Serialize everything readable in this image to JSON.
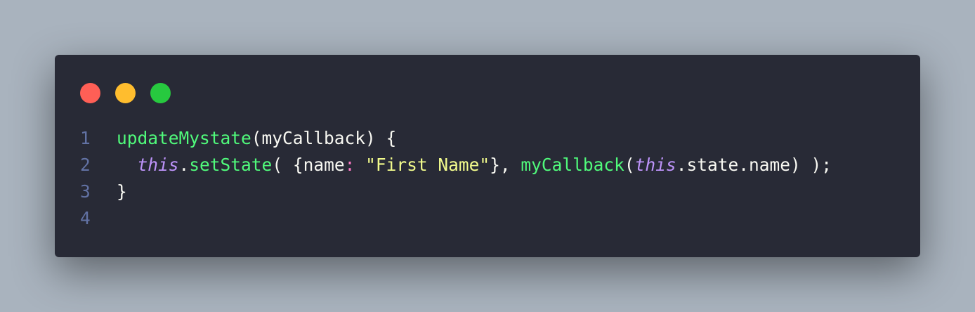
{
  "theme": {
    "background": "#282a36",
    "foreground": "#f8f8f2",
    "line_number": "#6272a4",
    "function": "#50fa7b",
    "keyword": "#bd93f9",
    "string": "#f1fa8c",
    "operator": "#ff79c6",
    "window_close": "#ff5f56",
    "window_minimize": "#ffbd2e",
    "window_maximize": "#27c93f"
  },
  "window_controls": [
    "close",
    "minimize",
    "maximize"
  ],
  "code": {
    "language": "javascript",
    "lines": [
      {
        "number": "1",
        "tokens": [
          {
            "text": "updateMystate",
            "type": "function"
          },
          {
            "text": "(myCallback) {",
            "type": "plain"
          }
        ]
      },
      {
        "number": "2",
        "tokens": [
          {
            "text": "  ",
            "type": "plain"
          },
          {
            "text": "this",
            "type": "keyword",
            "italic": true
          },
          {
            "text": ".",
            "type": "plain"
          },
          {
            "text": "setState",
            "type": "function"
          },
          {
            "text": "( {name",
            "type": "plain"
          },
          {
            "text": ":",
            "type": "operator"
          },
          {
            "text": " ",
            "type": "plain"
          },
          {
            "text": "\"First Name\"",
            "type": "string"
          },
          {
            "text": "}, ",
            "type": "plain"
          },
          {
            "text": "myCallback",
            "type": "function"
          },
          {
            "text": "(",
            "type": "plain"
          },
          {
            "text": "this",
            "type": "keyword",
            "italic": true
          },
          {
            "text": ".state.name) );",
            "type": "plain"
          }
        ]
      },
      {
        "number": "3",
        "tokens": [
          {
            "text": "}",
            "type": "plain"
          }
        ]
      },
      {
        "number": "4",
        "tokens": []
      }
    ]
  }
}
